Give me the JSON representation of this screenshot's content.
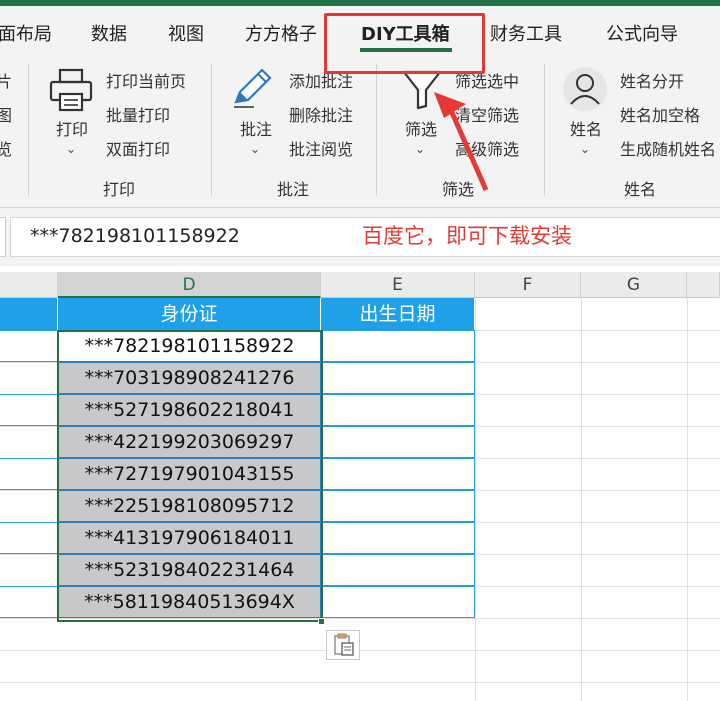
{
  "colors": {
    "accent": "#217346",
    "highlight": "#e53935",
    "table_header": "#1ea1e8"
  },
  "tabs": [
    {
      "label": "面布局"
    },
    {
      "label": "数据"
    },
    {
      "label": "视图"
    },
    {
      "label": "方方格子"
    },
    {
      "label": "DIY工具箱",
      "active": true
    },
    {
      "label": "财务工具"
    },
    {
      "label": "公式向导"
    }
  ],
  "ribbon": {
    "left_partial": [
      "片",
      "图",
      "览"
    ],
    "print_group": {
      "big_button": "打印",
      "items": [
        "打印当前页",
        "批量打印",
        "双面打印"
      ],
      "label": "打印"
    },
    "comment_group": {
      "big_button": "批注",
      "items": [
        "添加批注",
        "删除批注",
        "批注阅览"
      ],
      "label": "批注"
    },
    "filter_group": {
      "big_button": "筛选",
      "items": [
        "筛选选中",
        "清空筛选",
        "高级筛选"
      ],
      "label": "筛选"
    },
    "name_group": {
      "big_button": "姓名",
      "items": [
        "姓名分开",
        "姓名加空格",
        "生成随机姓名"
      ],
      "label": "姓名"
    }
  },
  "formula_bar": {
    "value": "***782198101158922"
  },
  "annotation": "百度它，即可下载安装",
  "columns": [
    "D",
    "E",
    "F",
    "G"
  ],
  "table": {
    "headers": [
      "身份证",
      "出生日期"
    ],
    "ids": [
      "***782198101158922",
      "***703198908241276",
      "***527198602218041",
      "***422199203069297",
      "***727197901043155",
      "***225198108095712",
      "***413197906184011",
      "***523198402231464",
      "***58119840513694X"
    ]
  }
}
